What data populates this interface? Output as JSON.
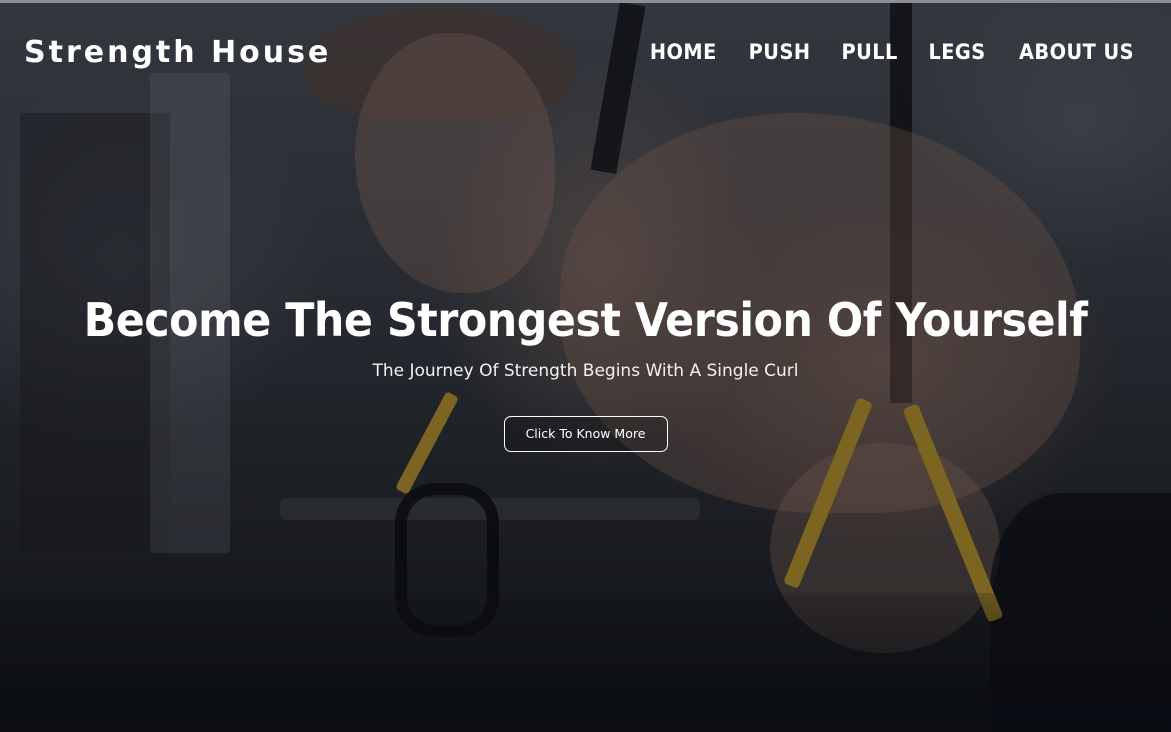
{
  "header": {
    "logo": "Strength House",
    "nav": [
      {
        "label": "HOME"
      },
      {
        "label": "PUSH"
      },
      {
        "label": "PULL"
      },
      {
        "label": "LEGS"
      },
      {
        "label": "ABOUT US"
      }
    ]
  },
  "hero": {
    "headline": "Become The Strongest Version Of Yourself",
    "subheadline": "The Journey Of Strength Begins With A Single Curl",
    "cta_label": "Click To Know More",
    "background_image": "man-doing-trx-pushups-gym-photo"
  },
  "colors": {
    "text": "#ffffff",
    "strap_accent": "#b8962a",
    "background_dark": "#111317"
  }
}
